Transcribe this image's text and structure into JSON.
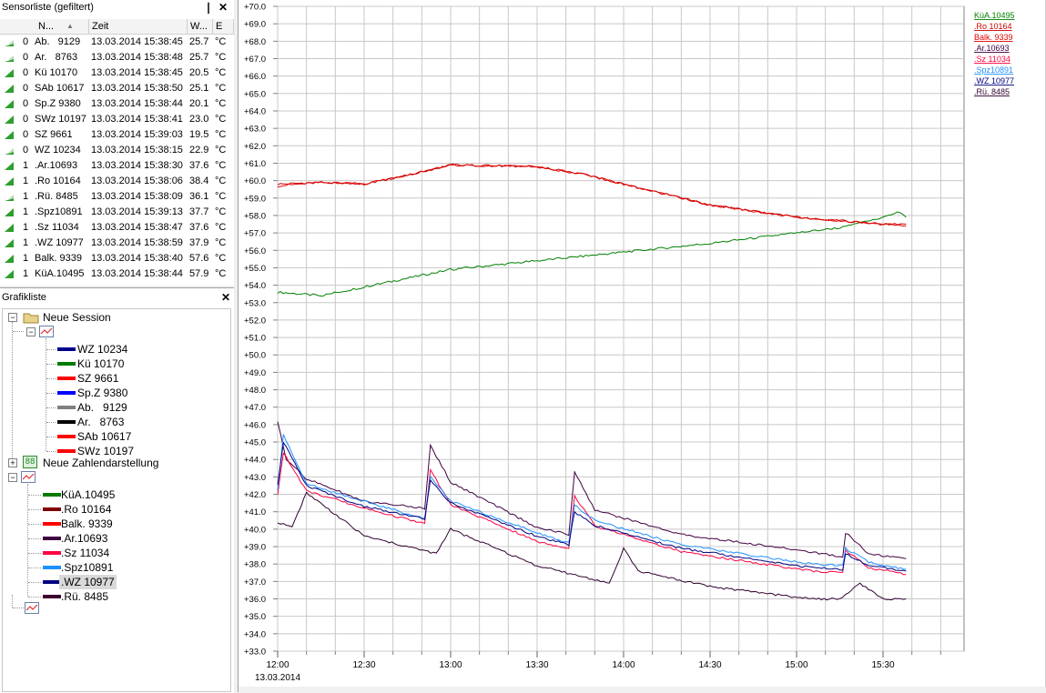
{
  "sensor_panel": {
    "title": "Sensorliste (gefiltert)",
    "pin_glyph": "❘",
    "close_glyph": "✕",
    "columns": [
      "N...",
      "Zeit",
      "W...",
      "E"
    ],
    "rows": [
      {
        "status": "0",
        "name": "Ab.   9129",
        "time": "13.03.2014 15:38:45",
        "value": "25.7",
        "unit": "°C",
        "signal": "low"
      },
      {
        "status": "0",
        "name": "Ar.   8763",
        "time": "13.03.2014 15:38:48",
        "value": "25.7",
        "unit": "°C",
        "signal": "low"
      },
      {
        "status": "0",
        "name": "Kü 10170",
        "time": "13.03.2014 15:38:45",
        "value": "20.5",
        "unit": "°C",
        "signal": "full"
      },
      {
        "status": "0",
        "name": "SAb 10617",
        "time": "13.03.2014 15:38:50",
        "value": "25.1",
        "unit": "°C",
        "signal": "full"
      },
      {
        "status": "0",
        "name": "Sp.Z 9380",
        "time": "13.03.2014 15:38:44",
        "value": "20.1",
        "unit": "°C",
        "signal": "full"
      },
      {
        "status": "0",
        "name": "SWz 10197",
        "time": "13.03.2014 15:38:41",
        "value": "23.0",
        "unit": "°C",
        "signal": "full"
      },
      {
        "status": "0",
        "name": "SZ 9661",
        "time": "13.03.2014 15:39:03",
        "value": "19.5",
        "unit": "°C",
        "signal": "full"
      },
      {
        "status": "0",
        "name": "WZ 10234",
        "time": "13.03.2014 15:38:15",
        "value": "22.9",
        "unit": "°C",
        "signal": "low"
      },
      {
        "status": "1",
        "name": ".Ar.10693",
        "time": "13.03.2014 15:38:30",
        "value": "37.6",
        "unit": "°C",
        "signal": "full"
      },
      {
        "status": "1",
        "name": ".Ro 10164",
        "time": "13.03.2014 15:38:06",
        "value": "38.4",
        "unit": "°C",
        "signal": "full"
      },
      {
        "status": "1",
        "name": ".Rü. 8485",
        "time": "13.03.2014 15:38:09",
        "value": "36.1",
        "unit": "°C",
        "signal": "low"
      },
      {
        "status": "1",
        "name": ".Spz10891",
        "time": "13.03.2014 15:39:13",
        "value": "37.7",
        "unit": "°C",
        "signal": "full"
      },
      {
        "status": "1",
        "name": ".Sz 11034",
        "time": "13.03.2014 15:38:47",
        "value": "37.6",
        "unit": "°C",
        "signal": "full"
      },
      {
        "status": "1",
        "name": ".WZ 10977",
        "time": "13.03.2014 15:38:59",
        "value": "37.9",
        "unit": "°C",
        "signal": "full"
      },
      {
        "status": "1",
        "name": "Balk. 9339",
        "time": "13.03.2014 15:38:40",
        "value": "57.6",
        "unit": "°C",
        "signal": "full"
      },
      {
        "status": "1",
        "name": "KüA.10495",
        "time": "13.03.2014 15:38:44",
        "value": "57.9",
        "unit": "°C",
        "signal": "full"
      }
    ]
  },
  "graph_panel": {
    "title": "Grafikliste",
    "close_glyph": "✕",
    "session_label": "Neue Session",
    "numbers_label": "Neue Zahlendarstellung",
    "numbers_icon_text": "88",
    "group1": [
      {
        "label": "WZ 10234",
        "color": "#00008b"
      },
      {
        "label": "Kü 10170",
        "color": "#007a00"
      },
      {
        "label": "SZ 9661",
        "color": "#ff0000"
      },
      {
        "label": "Sp.Z 9380",
        "color": "#0000ff"
      },
      {
        "label": "Ab.   9129",
        "color": "#808080"
      },
      {
        "label": "Ar.   8763",
        "color": "#000000"
      },
      {
        "label": "SAb 10617",
        "color": "#ff0000"
      },
      {
        "label": "SWz 10197",
        "color": "#ff0000"
      }
    ],
    "group2": [
      {
        "label": "KüA.10495",
        "color": "#007a00"
      },
      {
        "label": ".Ro 10164",
        "color": "#800000"
      },
      {
        "label": "Balk. 9339",
        "color": "#ff0000"
      },
      {
        "label": ".Ar.10693",
        "color": "#400040"
      },
      {
        "label": ".Sz 11034",
        "color": "#ff0040"
      },
      {
        "label": ".Spz10891",
        "color": "#1e90ff"
      },
      {
        "label": ".WZ 10977",
        "color": "#000080",
        "selected": true
      },
      {
        "label": ".Rü. 8485",
        "color": "#400030"
      }
    ]
  },
  "chart_data": {
    "type": "line",
    "x_unit": "time",
    "date_label": "13.03.2014",
    "x_range": [
      "12:00",
      "15:40"
    ],
    "x_ticks": [
      "12:00",
      "12:30",
      "13:00",
      "13:30",
      "14:00",
      "14:30",
      "15:00",
      "15:30"
    ],
    "ylim": [
      33.0,
      70.0
    ],
    "y_tick_step": 1.0,
    "y_tick_labels": [
      "+33.0",
      "+34.0",
      "+35.0",
      "+36.0",
      "+37.0",
      "+38.0",
      "+39.0",
      "+40.0",
      "+41.0",
      "+42.0",
      "+43.0",
      "+44.0",
      "+45.0",
      "+46.0",
      "+47.0",
      "+48.0",
      "+49.0",
      "+50.0",
      "+51.0",
      "+52.0",
      "+53.0",
      "+54.0",
      "+55.0",
      "+56.0",
      "+57.0",
      "+58.0",
      "+59.0",
      "+60.0",
      "+61.0",
      "+62.0",
      "+63.0",
      "+64.0",
      "+65.0",
      "+66.0",
      "+67.0",
      "+68.0",
      "+69.0",
      "+70.0"
    ],
    "grid": true,
    "legend_position": "top-right",
    "series": [
      {
        "name": "KüA.10495",
        "color": "#008000",
        "x": [
          "12:00",
          "12:15",
          "12:30",
          "13:00",
          "13:30",
          "14:00",
          "14:30",
          "15:00",
          "15:15",
          "15:20",
          "15:30",
          "15:35",
          "15:38"
        ],
        "y": [
          53.6,
          53.4,
          53.9,
          54.9,
          55.4,
          55.9,
          56.4,
          57.0,
          57.3,
          57.5,
          57.9,
          58.2,
          57.9
        ]
      },
      {
        "name": ".Ro 10164",
        "color": "#cc0000",
        "x": [
          "12:00",
          "12:15",
          "12:30",
          "12:45",
          "13:00",
          "13:30",
          "13:45",
          "14:00",
          "14:30",
          "15:00",
          "15:30",
          "15:38"
        ],
        "y": [
          59.8,
          59.9,
          59.8,
          60.3,
          60.9,
          60.8,
          60.4,
          59.8,
          58.6,
          57.9,
          57.5,
          57.5
        ]
      },
      {
        "name": "Balk. 9339",
        "color": "#e00000",
        "x": [
          "12:00",
          "12:15",
          "12:30",
          "12:45",
          "13:00",
          "13:30",
          "13:45",
          "14:00",
          "14:30",
          "15:00",
          "15:30",
          "15:38"
        ],
        "y": [
          59.7,
          59.9,
          59.8,
          60.3,
          60.9,
          60.8,
          60.4,
          59.8,
          58.6,
          57.9,
          57.5,
          57.4
        ]
      },
      {
        "name": ".Ar.10693",
        "color": "#400040",
        "x": [
          "12:00",
          "12:03",
          "12:10",
          "12:30",
          "12:51",
          "12:53",
          "13:00",
          "13:30",
          "13:41",
          "13:43",
          "13:50",
          "14:20",
          "15:05",
          "15:16",
          "15:17",
          "15:25",
          "15:38"
        ],
        "y": [
          46.2,
          44.0,
          42.9,
          41.6,
          41.2,
          44.8,
          42.7,
          40.1,
          39.7,
          43.3,
          41.1,
          39.7,
          38.7,
          38.4,
          39.8,
          38.6,
          38.3
        ]
      },
      {
        "name": ".Sz 11034",
        "color": "#ff0040",
        "x": [
          "12:00",
          "12:02",
          "12:10",
          "12:30",
          "12:51",
          "12:53",
          "13:00",
          "13:30",
          "13:41",
          "13:43",
          "13:50",
          "14:20",
          "15:05",
          "15:16",
          "15:17",
          "15:25",
          "15:38"
        ],
        "y": [
          42.0,
          44.4,
          42.2,
          41.2,
          40.3,
          43.4,
          41.4,
          39.3,
          38.9,
          41.9,
          40.2,
          38.7,
          37.6,
          37.5,
          38.8,
          37.8,
          37.4
        ]
      },
      {
        "name": ".Spz10891",
        "color": "#1e90ff",
        "x": [
          "12:00",
          "12:02",
          "12:10",
          "12:30",
          "12:51",
          "12:53",
          "13:00",
          "13:30",
          "13:41",
          "13:43",
          "13:50",
          "14:20",
          "15:05",
          "15:16",
          "15:17",
          "15:25",
          "15:38"
        ],
        "y": [
          42.3,
          45.4,
          42.6,
          41.6,
          40.6,
          43.0,
          41.6,
          39.8,
          39.2,
          41.4,
          40.5,
          39.1,
          38.0,
          37.9,
          38.9,
          38.1,
          37.7
        ]
      },
      {
        "name": ".WZ 10977",
        "color": "#000080",
        "x": [
          "12:00",
          "12:02",
          "12:10",
          "12:30",
          "12:51",
          "12:53",
          "13:00",
          "13:30",
          "13:41",
          "13:43",
          "13:50",
          "14:20",
          "15:05",
          "15:16",
          "15:17",
          "15:25",
          "15:38"
        ],
        "y": [
          42.5,
          45.0,
          42.5,
          41.3,
          40.6,
          42.8,
          41.5,
          39.6,
          39.1,
          41.0,
          40.2,
          38.9,
          37.8,
          37.7,
          38.6,
          37.9,
          37.6
        ]
      },
      {
        "name": ".Rü. 8485",
        "color": "#300030",
        "x": [
          "12:00",
          "12:05",
          "12:10",
          "12:30",
          "12:55",
          "13:00",
          "13:30",
          "13:50",
          "13:55",
          "14:00",
          "14:05",
          "14:30",
          "15:05",
          "15:15",
          "15:22",
          "15:30",
          "15:38"
        ],
        "y": [
          40.4,
          40.1,
          42.1,
          39.6,
          38.6,
          40.0,
          37.9,
          37.1,
          36.9,
          38.9,
          37.6,
          36.7,
          36.0,
          36.0,
          36.9,
          36.0,
          36.0
        ]
      }
    ]
  }
}
